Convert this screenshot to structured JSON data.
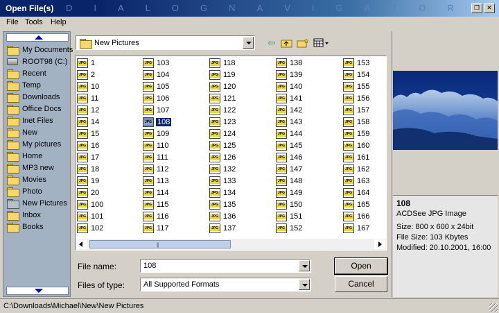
{
  "window": {
    "title": "Open File(s)",
    "brand_letters": [
      "D",
      "I",
      "A",
      "L",
      "O",
      "G",
      "N",
      "A",
      "V",
      "I",
      "G",
      "A",
      "T",
      "O",
      "R"
    ],
    "controls": {
      "restore_icon": "restore-icon",
      "close_icon": "close-icon"
    }
  },
  "menu": [
    "File",
    "Tools",
    "Help"
  ],
  "sidebar": {
    "items": [
      {
        "label": "My Documents",
        "icon": "folder-icon",
        "selected": false
      },
      {
        "label": "ROOT98 (C:)",
        "icon": "drive-icon",
        "selected": false
      },
      {
        "label": "Recent",
        "icon": "folder-icon",
        "selected": false
      },
      {
        "label": "Temp",
        "icon": "folder-icon",
        "selected": false
      },
      {
        "label": "Downloads",
        "icon": "folder-icon",
        "selected": false
      },
      {
        "label": "Office Docs",
        "icon": "folder-icon",
        "selected": false
      },
      {
        "label": "Inet Files",
        "icon": "folder-icon",
        "selected": false
      },
      {
        "label": "New",
        "icon": "folder-icon",
        "selected": false
      },
      {
        "label": "My pictures",
        "icon": "folder-icon",
        "selected": false
      },
      {
        "label": "Home",
        "icon": "folder-icon",
        "selected": false
      },
      {
        "label": "MP3 new",
        "icon": "folder-icon",
        "selected": false
      },
      {
        "label": "Movies",
        "icon": "folder-icon",
        "selected": false
      },
      {
        "label": "Photo",
        "icon": "folder-icon",
        "selected": false
      },
      {
        "label": "New Pictures",
        "icon": "folder-icon",
        "selected": true
      },
      {
        "label": "Inbox",
        "icon": "folder-icon",
        "selected": false
      },
      {
        "label": "Books",
        "icon": "folder-icon",
        "selected": false
      }
    ]
  },
  "toolbar": {
    "path": "New Pictures",
    "icons": [
      "back-arrow-icon",
      "up-folder-icon",
      "new-folder-icon",
      "view-menu-icon"
    ]
  },
  "files": {
    "columns": [
      [
        "1",
        "2",
        "10",
        "11",
        "12",
        "14",
        "15",
        "16",
        "17",
        "18",
        "19",
        "20",
        "100",
        "101",
        "102"
      ],
      [
        "103",
        "104",
        "105",
        "106",
        "107",
        "108",
        "109",
        "110",
        "111",
        "112",
        "113",
        "114",
        "115",
        "116",
        "117"
      ],
      [
        "118",
        "119",
        "120",
        "121",
        "122",
        "123",
        "124",
        "125",
        "126",
        "132",
        "133",
        "134",
        "135",
        "136",
        "137"
      ],
      [
        "138",
        "139",
        "140",
        "141",
        "142",
        "143",
        "144",
        "145",
        "146",
        "147",
        "148",
        "149",
        "150",
        "151",
        "152"
      ],
      [
        "153",
        "154",
        "155",
        "156",
        "157",
        "158",
        "159",
        "160",
        "161",
        "162",
        "163",
        "164",
        "165",
        "166",
        "167"
      ]
    ],
    "selected": "108"
  },
  "form": {
    "filename_label": "File name:",
    "filename_value": "108",
    "filetype_label": "Files of type:",
    "filetype_value": "All Supported Formats",
    "open_label": "Open",
    "cancel_label": "Cancel"
  },
  "preview": {
    "name": "108",
    "type": "ACDSee JPG Image",
    "size": "Size: 800 x 600 x 24bit",
    "file_size": "File Size: 103 Kbytes",
    "modified": "Modified: 20.10.2001, 16:00"
  },
  "status": "C:\\Downloads\\Michael\\New\\New Pictures"
}
